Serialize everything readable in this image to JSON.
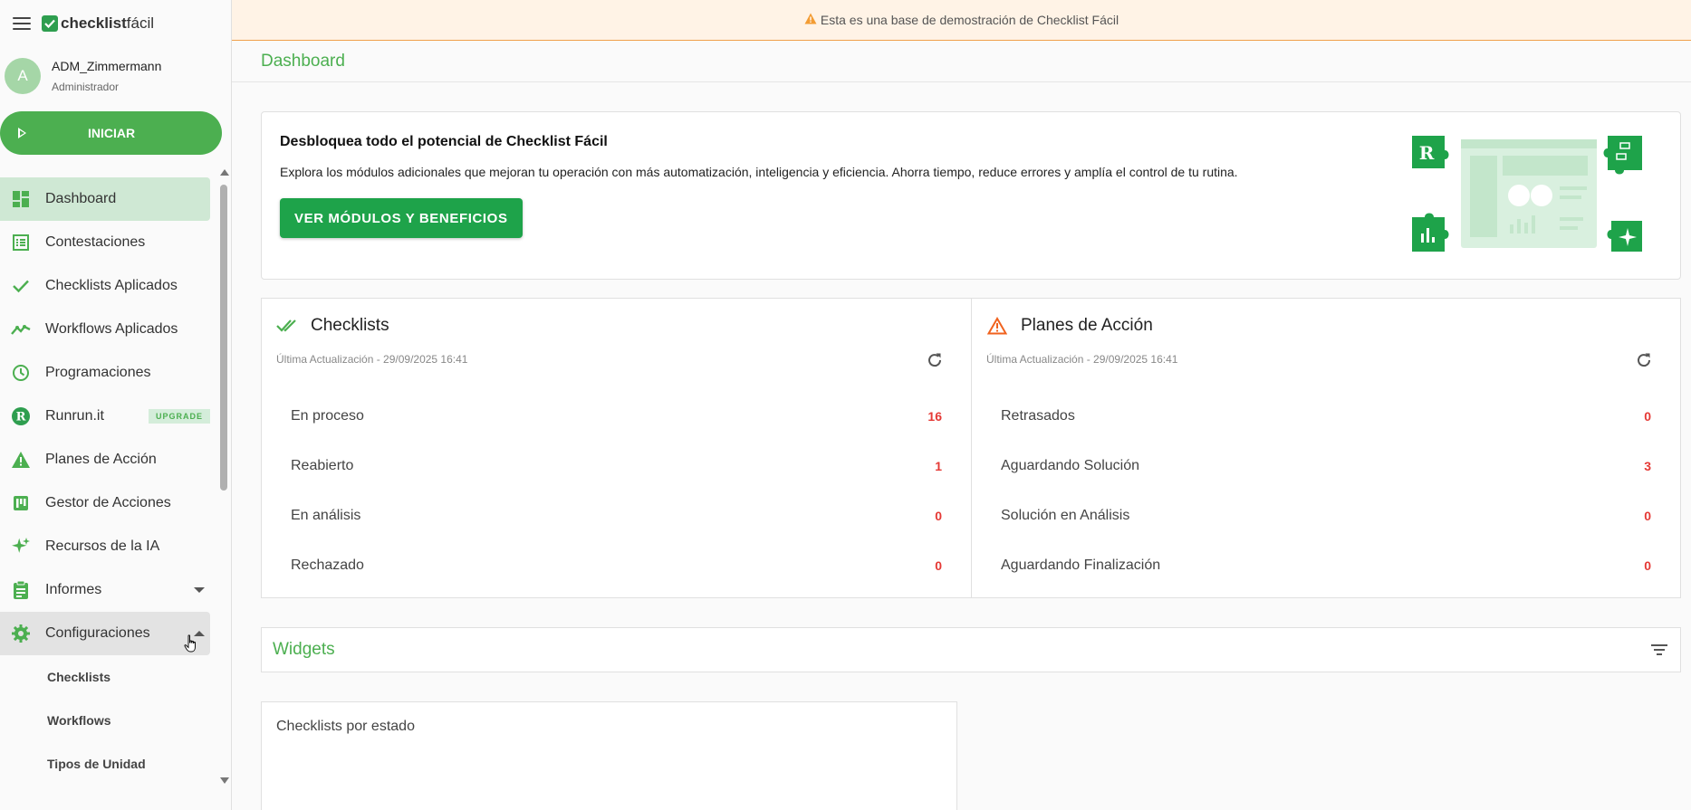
{
  "brand": {
    "name_bold": "checklist",
    "name_light": "fácil"
  },
  "user": {
    "initial": "A",
    "name": "ADM_Zimmermann",
    "role": "Administrador"
  },
  "start_button": {
    "label": "INICIAR"
  },
  "sidebar": {
    "items": [
      {
        "label": "Dashboard",
        "icon": "dashboard-icon"
      },
      {
        "label": "Contestaciones",
        "icon": "list-icon"
      },
      {
        "label": "Checklists Aplicados",
        "icon": "check-icon"
      },
      {
        "label": "Workflows Aplicados",
        "icon": "trending-icon"
      },
      {
        "label": "Programaciones",
        "icon": "clock-icon"
      },
      {
        "label": "Runrun.it",
        "icon": "runrun-icon",
        "badge": "UPGRADE"
      },
      {
        "label": "Planes de Acción",
        "icon": "warning-icon"
      },
      {
        "label": "Gestor de Acciones",
        "icon": "board-icon"
      },
      {
        "label": "Recursos de la IA",
        "icon": "sparkle-icon"
      },
      {
        "label": "Informes",
        "icon": "clipboard-icon"
      },
      {
        "label": "Configuraciones",
        "icon": "gear-icon"
      }
    ],
    "subitems": [
      {
        "label": "Checklists"
      },
      {
        "label": "Workflows"
      },
      {
        "label": "Tipos de Unidad"
      }
    ]
  },
  "banner": {
    "text": "Esta es una base de demostración de Checklist Fácil"
  },
  "page": {
    "title": "Dashboard"
  },
  "promo": {
    "title": "Desbloquea todo el potencial de Checklist Fácil",
    "text": "Explora los módulos adicionales que mejoran tu operación con más automatización, inteligencia y eficiencia. Ahorra tiempo, reduce errores y amplía el control de tu rutina.",
    "button": "VER MÓDULOS Y BENEFICIOS"
  },
  "checklists_panel": {
    "title": "Checklists",
    "updated": "Última Actualización - 29/09/2025 16:41",
    "rows": [
      {
        "label": "En proceso",
        "value": "16"
      },
      {
        "label": "Reabierto",
        "value": "1"
      },
      {
        "label": "En análisis",
        "value": "0"
      },
      {
        "label": "Rechazado",
        "value": "0"
      }
    ]
  },
  "plans_panel": {
    "title": "Planes de Acción",
    "updated": "Última Actualización - 29/09/2025 16:41",
    "rows": [
      {
        "label": "Retrasados",
        "value": "0"
      },
      {
        "label": "Aguardando Solución",
        "value": "3"
      },
      {
        "label": "Solución en Análisis",
        "value": "0"
      },
      {
        "label": "Aguardando Finalización",
        "value": "0"
      }
    ]
  },
  "widgets": {
    "title": "Widgets"
  },
  "chart_card": {
    "title": "Checklists por estado"
  },
  "colors": {
    "brand_green": "#4caf50",
    "button_green": "#1ea34a",
    "alert_red": "#e53935",
    "warning_orange": "#f0a04b"
  }
}
